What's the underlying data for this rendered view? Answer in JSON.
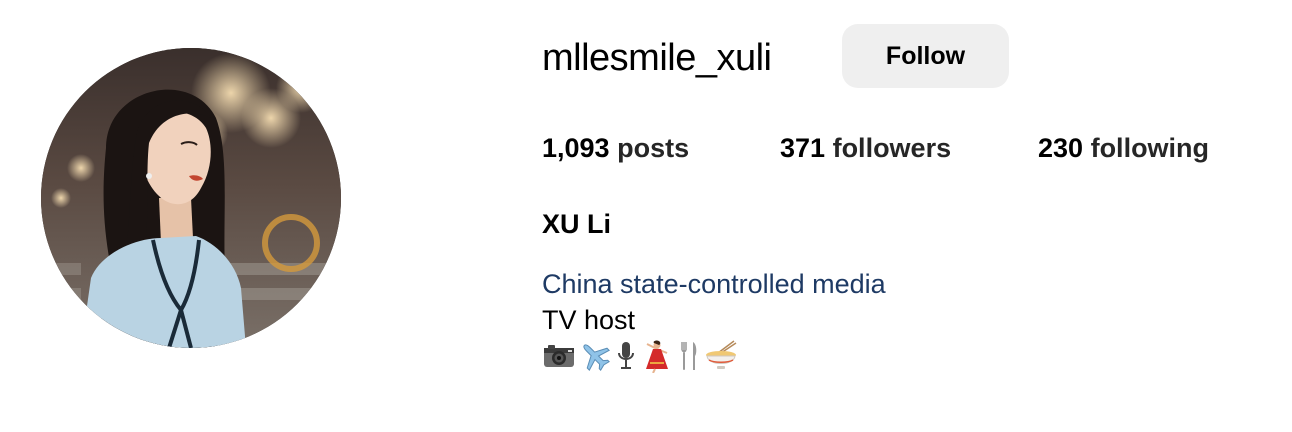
{
  "profile": {
    "username": "mllesmile_xuli",
    "follow_label": "Follow",
    "full_name": "XU Li",
    "media_label": "China state-controlled media",
    "bio_line": "TV host",
    "bio_emojis": [
      "camera-icon",
      "airplane-icon",
      "microphone-icon",
      "dancer-icon",
      "fork-knife-icon",
      "noodle-bowl-icon"
    ]
  },
  "stats": {
    "posts": {
      "count": "1,093",
      "label": "posts"
    },
    "followers": {
      "count": "371",
      "label": "followers"
    },
    "following": {
      "count": "230",
      "label": "following"
    }
  },
  "colors": {
    "follow_button_bg": "#efefef",
    "media_label": "#1e3a64",
    "text": "#000000",
    "background": "#ffffff"
  }
}
